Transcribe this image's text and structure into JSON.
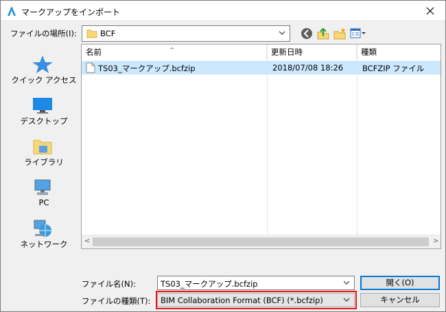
{
  "window": {
    "title": "マークアップをインポート"
  },
  "lookin": {
    "label": "ファイルの場所(I):",
    "value": "BCF"
  },
  "places": [
    {
      "label": "クイック アクセス",
      "icon": "star-icon"
    },
    {
      "label": "デスクトップ",
      "icon": "desktop-icon"
    },
    {
      "label": "ライブラリ",
      "icon": "library-icon"
    },
    {
      "label": "PC",
      "icon": "pc-icon"
    },
    {
      "label": "ネットワーク",
      "icon": "network-icon"
    }
  ],
  "filelist": {
    "columns": [
      "名前",
      "更新日時",
      "種類"
    ],
    "rows": [
      {
        "name": "TS03_マークアップ.bcfzip",
        "date": "2018/07/08 18:26",
        "type": "BCFZIP ファイル"
      }
    ]
  },
  "filename": {
    "label": "ファイル名(N):",
    "value": "TS03_マークアップ.bcfzip"
  },
  "filetype": {
    "label": "ファイルの種類(T):",
    "value": "BIM Collaboration Format (BCF) (*.bcfzip)"
  },
  "buttons": {
    "open": "開く(O)",
    "cancel": "キャンセル"
  },
  "colors": {
    "selection": "#cce8ff",
    "highlight": "#e8141f",
    "accent": "#0078d7"
  }
}
